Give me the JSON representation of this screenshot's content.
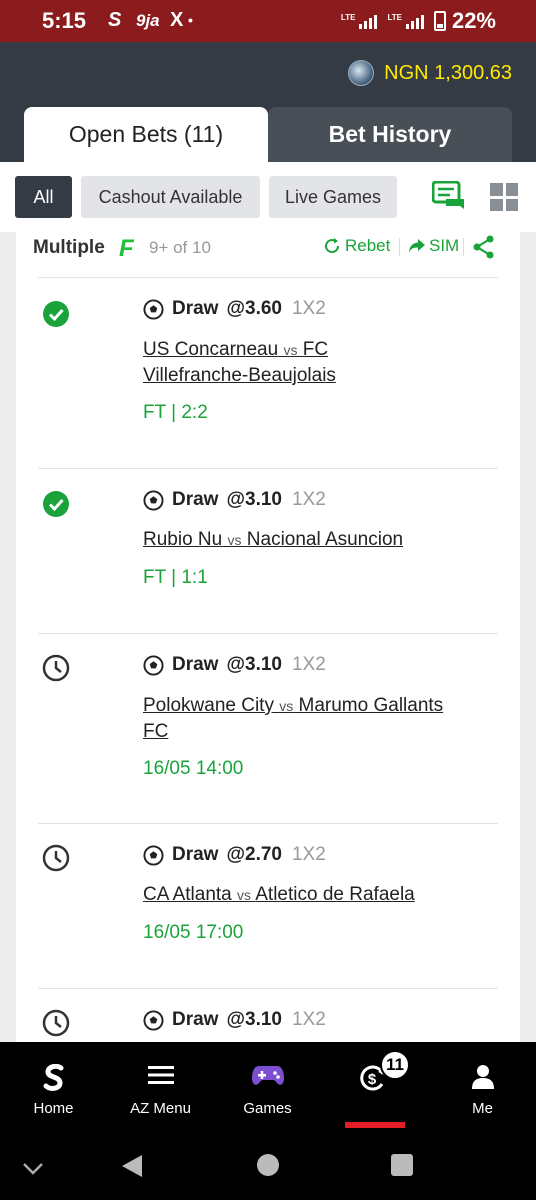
{
  "status_bar": {
    "time": "5:15",
    "app_icons": [
      "S",
      "9ja",
      "X",
      "•"
    ],
    "network_1": "LTE",
    "network_2": "LTE",
    "battery": "22%"
  },
  "header": {
    "currency": "NGN",
    "balance": "1,300.63",
    "balance_label": "NGN 1,300.63"
  },
  "tabs": [
    {
      "label": "Open Bets (11)",
      "active": true
    },
    {
      "label": "Bet History",
      "active": false
    }
  ],
  "filters": [
    {
      "label": "All",
      "active": true
    },
    {
      "label": "Cashout Available",
      "active": false
    },
    {
      "label": "Live Games",
      "active": false
    }
  ],
  "bet_card": {
    "type": "Multiple",
    "flexi_label": "9+ of 10",
    "rebet_label": "Rebet",
    "sim_label": "SIM",
    "selections": [
      {
        "status": "won",
        "status_icon": "check-circle-icon",
        "pick": "Draw",
        "odds": "@3.60",
        "market": "1X2",
        "home": "US Concarneau",
        "away_line1": "FC",
        "away_line2": "Villefranche-Beaujolais",
        "vs": "vs",
        "result": "FT | 2:2"
      },
      {
        "status": "won",
        "status_icon": "check-circle-icon",
        "pick": "Draw",
        "odds": "@3.10",
        "market": "1X2",
        "home": "Rubio Nu",
        "away": "Nacional Asuncion",
        "vs": "vs",
        "result": "FT | 1:1"
      },
      {
        "status": "pending",
        "status_icon": "clock-icon",
        "pick": "Draw",
        "odds": "@3.10",
        "market": "1X2",
        "home": "Polokwane City",
        "away_line1": "Marumo Gallants",
        "away_line2": "FC",
        "vs": "vs",
        "result": "16/05 14:00"
      },
      {
        "status": "pending",
        "status_icon": "clock-icon",
        "pick": "Draw",
        "odds": "@2.70",
        "market": "1X2",
        "home": "CA Atlanta",
        "away": "Atletico de Rafaela",
        "vs": "vs",
        "result": "16/05 17:00"
      },
      {
        "status": "pending",
        "status_icon": "clock-icon",
        "pick": "Draw",
        "odds": "@3.10",
        "market": "1X2"
      }
    ]
  },
  "bottom_nav": [
    {
      "label": "Home",
      "icon": "sportybet-logo-icon"
    },
    {
      "label": "AZ Menu",
      "icon": "menu-icon"
    },
    {
      "label": "Games",
      "icon": "gamepad-icon"
    },
    {
      "label": "",
      "icon": "bets-icon",
      "badge": "11",
      "active": true
    },
    {
      "label": "Me",
      "icon": "person-icon"
    }
  ],
  "colors": {
    "status_bar": "#8b1b1d",
    "header": "#353b44",
    "accent_green": "#1aa33a",
    "balance_yellow": "#ffe900",
    "active_red": "#e41e26"
  }
}
